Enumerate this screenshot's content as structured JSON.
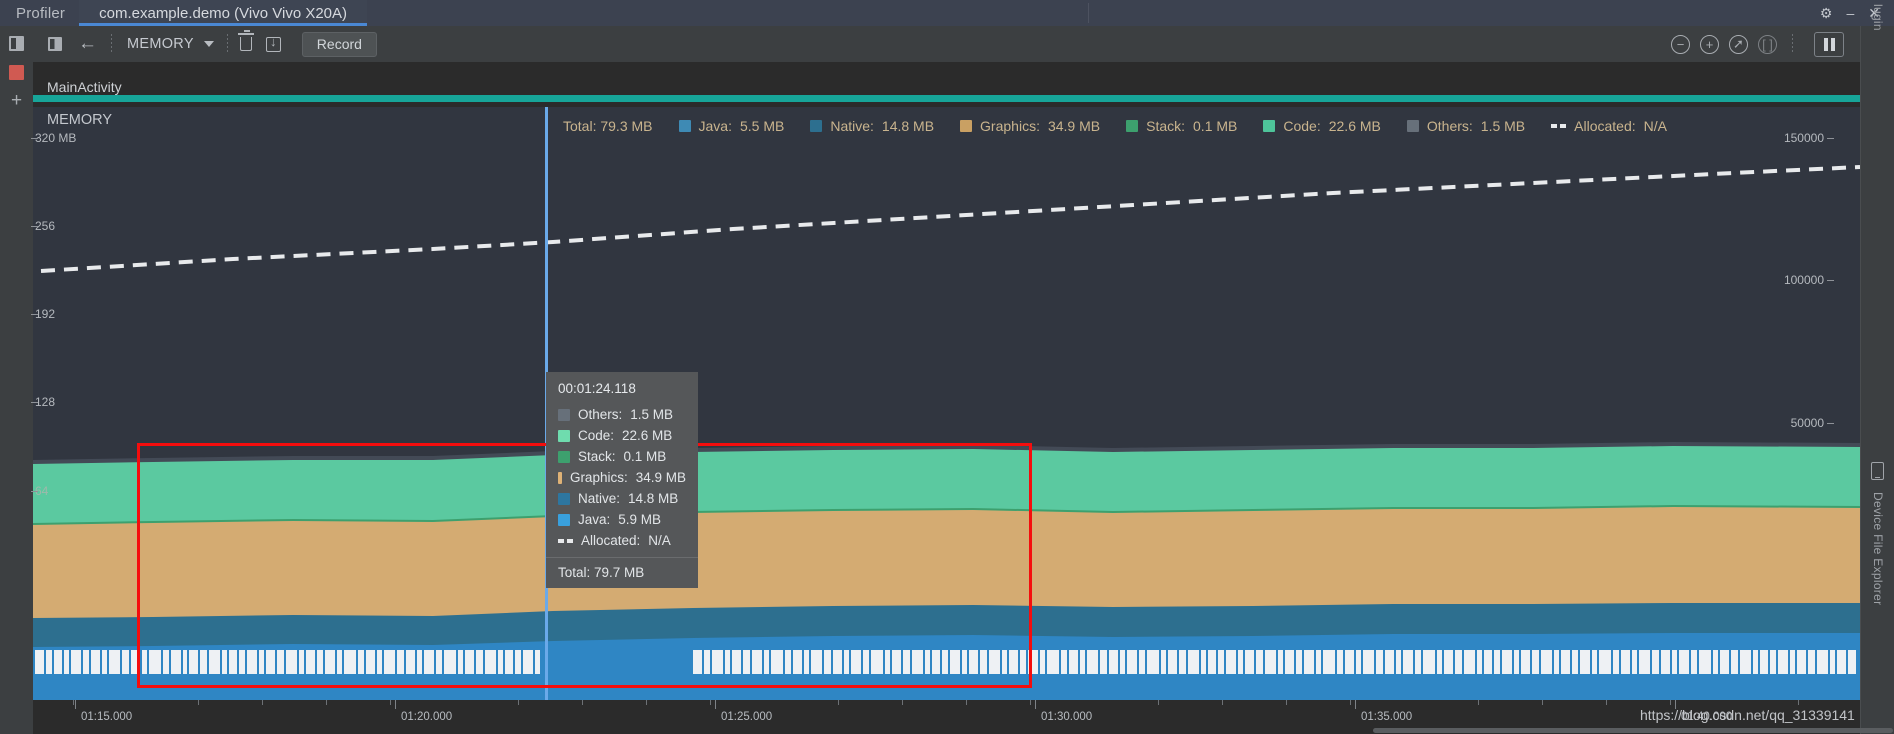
{
  "window": {
    "tab_profiler": "Profiler",
    "tab_app": "com.example.demo (Vivo Vivo X20A)",
    "settings_icon": "gear-icon",
    "minimize_icon": "minimize-icon",
    "close_icon": "close-icon"
  },
  "left_rail": {
    "split_icon": "split-layout-icon",
    "stop_icon": "stop-session-icon",
    "add_icon": "add-session-icon"
  },
  "right_rail": {
    "plugin_label": "lugin",
    "device_file_explorer_label": "Device File Explorer",
    "device_icon": "device-icon"
  },
  "toolbar": {
    "panel_toggle_icon": "panel-toggle-icon",
    "back_icon": "back-arrow-icon",
    "selector_value": "MEMORY",
    "caret_icon": "chevron-down-icon",
    "trash_icon": "trash-icon",
    "export_icon": "export-icon",
    "record_label": "Record",
    "zoom_out_icon": "zoom-out-icon",
    "zoom_in_icon": "zoom-in-icon",
    "reset_zoom_icon": "reset-zoom-icon",
    "attach_live_icon": "attach-to-live-icon",
    "pause_icon": "pause-icon"
  },
  "event_strip": {
    "activity_label": "MainActivity",
    "activity_color": "#17a599"
  },
  "chart_panel": {
    "title": "MEMORY",
    "legend_total": "Total: 79.3 MB",
    "legend": [
      {
        "label": "Java:",
        "value": "5.5 MB",
        "color": "#3e8ab4"
      },
      {
        "label": "Native:",
        "value": "14.8 MB",
        "color": "#2d6f8f"
      },
      {
        "label": "Graphics:",
        "value": "34.9 MB",
        "color": "#c9a063"
      },
      {
        "label": "Stack:",
        "value": "0.1 MB",
        "color": "#3da06e"
      },
      {
        "label": "Code:",
        "value": "22.6 MB",
        "color": "#4ec49a"
      },
      {
        "label": "Others:",
        "value": "1.5 MB",
        "color": "#67707a"
      },
      {
        "label": "Allocated:",
        "value": "N/A",
        "color": "#e8eaec",
        "dashed": true
      }
    ]
  },
  "tooltip": {
    "time": "00:01:24.118",
    "rows": [
      {
        "label": "Others:",
        "value": "1.5 MB",
        "color": "#67707a"
      },
      {
        "label": "Code:",
        "value": "22.6 MB",
        "color": "#6fdcae"
      },
      {
        "label": "Stack:",
        "value": "0.1 MB",
        "color": "#3da06e"
      },
      {
        "label": "Graphics:",
        "value": "34.9 MB",
        "color": "#dfb276"
      },
      {
        "label": "Native:",
        "value": "14.8 MB",
        "color": "#2d76a0"
      },
      {
        "label": "Java:",
        "value": "5.9 MB",
        "color": "#39a0dd"
      },
      {
        "label": "Allocated:",
        "value": "N/A",
        "color": "#e8eaec",
        "dashed": true
      }
    ],
    "total": "Total: 79.7 MB"
  },
  "watermark": "https://blog.csdn.net/qq_31339141",
  "chart_data": {
    "type": "area",
    "title": "MEMORY",
    "xlabel": "",
    "ylabel": "MB",
    "ylim": [
      0,
      352
    ],
    "y_ticks": [
      "320 MB",
      "256",
      "192",
      "128",
      "64"
    ],
    "y_tick_values": [
      320,
      256,
      192,
      128,
      64
    ],
    "y2_ticks": [
      "150000",
      "100000",
      "50000"
    ],
    "y2_tick_values": [
      150000,
      100000,
      50000
    ],
    "y2lim": [
      0,
      165000
    ],
    "x_ticks": [
      "01:15.000",
      "01:20.000",
      "01:25.000",
      "01:30.000",
      "01:35.000",
      "01:40.000"
    ],
    "xlim": [
      "01:13.000",
      "01:41.500"
    ],
    "grid": false,
    "legend_position": "top",
    "series": [
      {
        "name": "Java",
        "color": "#2f86c4",
        "values": [
          5.9,
          5.8,
          5.9,
          6.0,
          5.9,
          5.8,
          5.9,
          6.1,
          5.9,
          5.8,
          5.9,
          5.9,
          6.0,
          5.9,
          5.8,
          5.9,
          5.9,
          5.9,
          5.8,
          5.9
        ]
      },
      {
        "name": "Native",
        "color": "#2d6f8f",
        "values": [
          14.8,
          14.8,
          14.9,
          14.8,
          14.7,
          14.8,
          14.9,
          14.8,
          14.8,
          14.9,
          14.8,
          14.8,
          14.7,
          14.8,
          14.9,
          14.8,
          14.8,
          14.8,
          14.9,
          14.8
        ]
      },
      {
        "name": "Graphics",
        "color": "#d4ab72",
        "values": [
          34.6,
          34.7,
          34.9,
          34.9,
          35.0,
          34.9,
          34.8,
          34.9,
          35.1,
          35.2,
          35.0,
          34.9,
          34.9,
          35.0,
          35.1,
          35.0,
          34.9,
          34.9,
          35.0,
          34.9
        ]
      },
      {
        "name": "Stack",
        "color": "#3da06e",
        "values": [
          0.1,
          0.1,
          0.1,
          0.1,
          0.1,
          0.1,
          0.1,
          0.1,
          0.1,
          0.1,
          0.1,
          0.1,
          0.1,
          0.1,
          0.1,
          0.1,
          0.1,
          0.1,
          0.1,
          0.1
        ]
      },
      {
        "name": "Code",
        "color": "#5bc9a0",
        "values": [
          22.4,
          22.5,
          22.6,
          22.6,
          22.6,
          22.5,
          22.6,
          22.7,
          22.6,
          22.6,
          22.5,
          22.6,
          22.6,
          22.7,
          22.6,
          22.6,
          22.6,
          22.5,
          22.6,
          22.6
        ]
      },
      {
        "name": "Others",
        "color": "#67707a",
        "values": [
          1.5,
          1.5,
          1.5,
          1.5,
          1.5,
          1.5,
          1.5,
          1.5,
          1.5,
          1.5,
          1.5,
          1.5,
          1.5,
          1.5,
          1.5,
          1.5,
          1.5,
          1.5,
          1.5,
          1.5
        ]
      }
    ],
    "allocated_line": {
      "name": "Allocated",
      "color": "#e8eaec",
      "style": "dashed",
      "axis": "right",
      "values": [
        92000,
        94000,
        96000,
        98000,
        100000,
        103000,
        106000,
        109000,
        112000,
        115000,
        118000,
        121000,
        124000,
        127000,
        130000,
        133000,
        136000,
        139000,
        141000,
        143000
      ]
    },
    "annotation": {
      "type": "rect",
      "color": "#f50d0d"
    }
  }
}
